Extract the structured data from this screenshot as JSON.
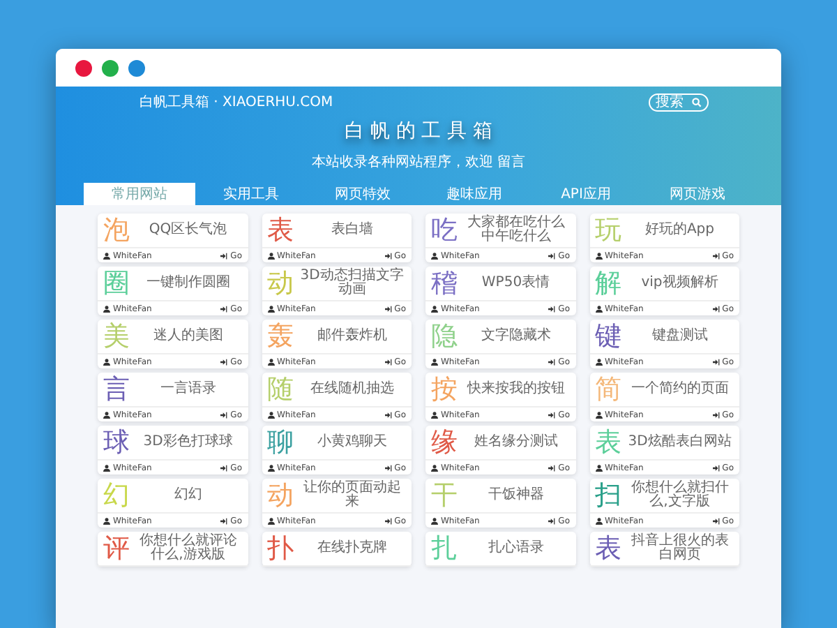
{
  "browser": {
    "dots": [
      {
        "color": "#e8173f"
      },
      {
        "color": "#22b04b"
      },
      {
        "color": "#1e8ad6"
      }
    ]
  },
  "header": {
    "site_name": "白帆工具箱 · XIAOERHU.COM",
    "search": {
      "placeholder": "搜索"
    },
    "title": "白 帆 的 工 具 箱",
    "subtitle": "本站收录各种网站程序，欢迎 留言"
  },
  "tabs": [
    {
      "label": "常用网站",
      "selected": true
    },
    {
      "label": "实用工具",
      "selected": false
    },
    {
      "label": "网页特效",
      "selected": false
    },
    {
      "label": "趣味应用",
      "selected": false
    },
    {
      "label": "API应用",
      "selected": false
    },
    {
      "label": "网页游戏",
      "selected": false
    }
  ],
  "cards": [
    {
      "glyph": "泡",
      "color": "#f4a460",
      "description": "QQ区长气泡",
      "author": "WhiteFan",
      "action": "Go"
    },
    {
      "glyph": "表",
      "color": "#e05a47",
      "description": "表白墙",
      "author": "WhiteFan",
      "action": "Go"
    },
    {
      "glyph": "吃",
      "color": "#7b6fc4",
      "description": "大家都在吃什么中午吃什么",
      "author": "WhiteFan",
      "action": "Go"
    },
    {
      "glyph": "玩",
      "color": "#b5cf6b",
      "description": "好玩的App",
      "author": "WhiteFan",
      "action": "Go"
    },
    {
      "glyph": "圈",
      "color": "#5ccf9a",
      "description": "一键制作圆圈",
      "author": "WhiteFan",
      "action": "Go"
    },
    {
      "glyph": "动",
      "color": "#c8c84a",
      "description": "3D动态扫描文字动画",
      "author": "WhiteFan",
      "action": "Go"
    },
    {
      "glyph": "稽",
      "color": "#7b6fc4",
      "description": "WP50表情",
      "author": "WhiteFan",
      "action": "Go"
    },
    {
      "glyph": "解",
      "color": "#5ccf9a",
      "description": "vip视频解析",
      "author": "WhiteFan",
      "action": "Go"
    },
    {
      "glyph": "美",
      "color": "#b5cf6b",
      "description": "迷人的美图",
      "author": "WhiteFan",
      "action": "Go"
    },
    {
      "glyph": "轰",
      "color": "#f4a460",
      "description": "邮件轰炸机",
      "author": "WhiteFan",
      "action": "Go"
    },
    {
      "glyph": "隐",
      "color": "#8fd18b",
      "description": "文字隐藏术",
      "author": "WhiteFan",
      "action": "Go"
    },
    {
      "glyph": "键",
      "color": "#6c5fb4",
      "description": "键盘测试",
      "author": "WhiteFan",
      "action": "Go"
    },
    {
      "glyph": "言",
      "color": "#6c5fb4",
      "description": "一言语录",
      "author": "WhiteFan",
      "action": "Go"
    },
    {
      "glyph": "随",
      "color": "#b5cf6b",
      "description": "在线随机抽选",
      "author": "WhiteFan",
      "action": "Go"
    },
    {
      "glyph": "按",
      "color": "#f4a460",
      "description": "快来按我的按钮",
      "author": "WhiteFan",
      "action": "Go"
    },
    {
      "glyph": "简",
      "color": "#f4b87a",
      "description": "一个简约的页面",
      "author": "WhiteFan",
      "action": "Go"
    },
    {
      "glyph": "球",
      "color": "#6c5fb4",
      "description": "3D彩色打球球",
      "author": "WhiteFan",
      "action": "Go"
    },
    {
      "glyph": "聊",
      "color": "#3aa0a0",
      "description": "小黄鸡聊天",
      "author": "WhiteFan",
      "action": "Go"
    },
    {
      "glyph": "缘",
      "color": "#e05a47",
      "description": "姓名缘分测试",
      "author": "WhiteFan",
      "action": "Go"
    },
    {
      "glyph": "表",
      "color": "#5ccf9a",
      "description": "3D炫酷表白网站",
      "author": "WhiteFan",
      "action": "Go"
    },
    {
      "glyph": "幻",
      "color": "#c8d84a",
      "description": "幻幻",
      "author": "WhiteFan",
      "action": "Go"
    },
    {
      "glyph": "动",
      "color": "#f4a460",
      "description": "让你的页面动起来",
      "author": "WhiteFan",
      "action": "Go"
    },
    {
      "glyph": "干",
      "color": "#b5cf6b",
      "description": "干饭神器",
      "author": "WhiteFan",
      "action": "Go"
    },
    {
      "glyph": "扫",
      "color": "#2aa08a",
      "description": "你想什么就扫什么,文字版",
      "author": "WhiteFan",
      "action": "Go"
    },
    {
      "glyph": "评",
      "color": "#e05a47",
      "description": "你想什么就评论什么,游戏版"
    },
    {
      "glyph": "扑",
      "color": "#e05a47",
      "description": "在线扑克牌"
    },
    {
      "glyph": "扎",
      "color": "#5ccf9a",
      "description": "扎心语录"
    },
    {
      "glyph": "表",
      "color": "#6c5fb4",
      "description": "抖音上很火的表白网页"
    }
  ]
}
